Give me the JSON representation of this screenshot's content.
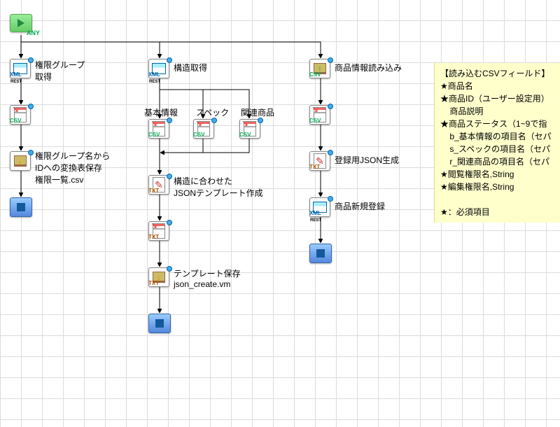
{
  "start_tag": "ANY",
  "labels": {
    "perm_get": "権限グループ\n取得",
    "struct_get": "構造取得",
    "prod_load": "商品情報読み込み",
    "perm_save": "権限グループ名から\nIDへの変換表保存\n権限一覧.csv",
    "basic": "基本情報",
    "spec": "スペック",
    "related": "関連商品",
    "json_tpl": "構造に合わせた\nJSONテンプレート作成",
    "tpl_save": "テンプレート保存\njson_create.vm",
    "json_gen": "登録用JSON生成",
    "prod_new": "商品新規登録"
  },
  "tags": {
    "xml": "XML",
    "csv": "CSV",
    "txt": "TXT"
  },
  "note": "【読み込むCSVフィールド】\n★商品名\n★商品ID（ユーザー設定用）\n    商品説明\n★商品ステータス（1~9で指\n    b_基本情報の項目名（セパ\n    s_スペックの項目名（セパ\n    r_関連商品の項目名（セパ\n★閲覧権限名,String\n★編集権限名,String\n\n★：必須項目"
}
